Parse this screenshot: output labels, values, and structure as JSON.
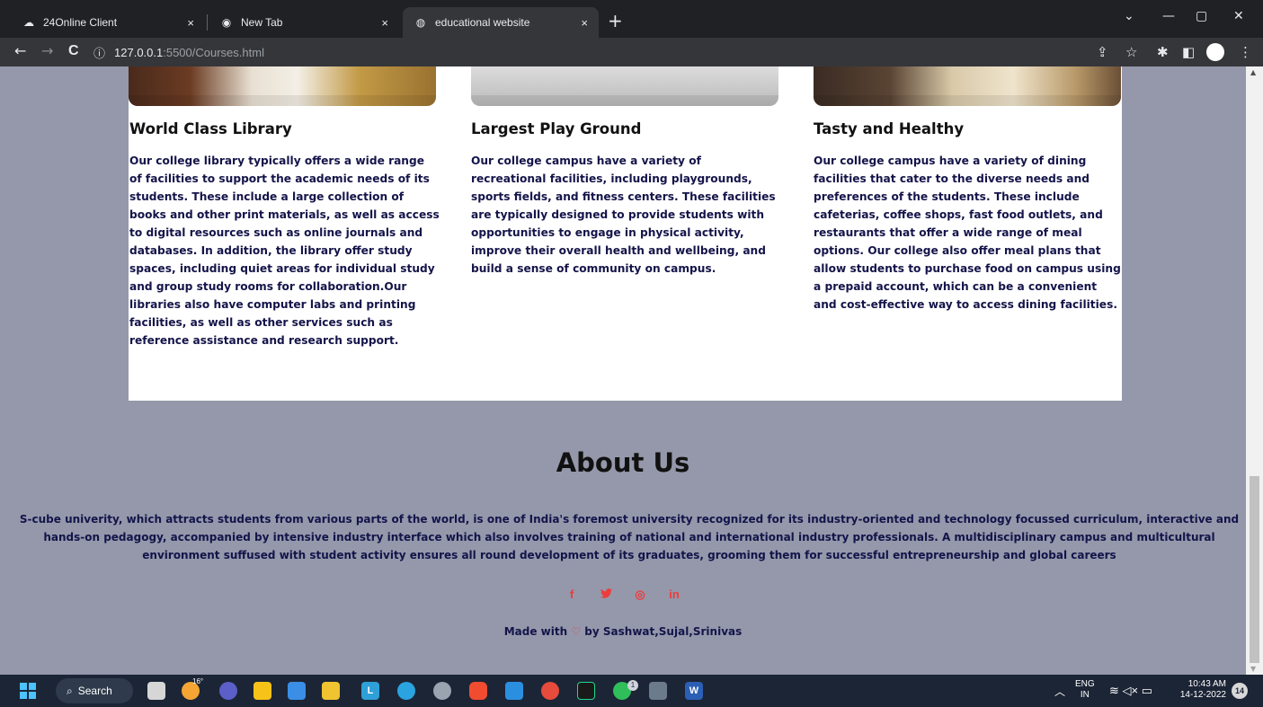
{
  "browser": {
    "tabs": [
      {
        "title": "24Online Client",
        "icon": "cloud-icon",
        "close": "×"
      },
      {
        "title": "New Tab",
        "icon": "chrome-icon",
        "close": "×"
      },
      {
        "title": "educational website",
        "icon": "globe-icon",
        "close": "×"
      }
    ],
    "new_tab": "+",
    "address": {
      "host": "127.0.0.1",
      "path": ":5500/Courses.html"
    },
    "controls": {
      "back": "←",
      "forward": "→",
      "reload": "C",
      "info": "ⓘ",
      "minimize": "—",
      "restore": "▢",
      "close": "✕",
      "tablist": "⌄"
    },
    "toolbar_icons": {
      "share": "⇪",
      "star": "☆",
      "extensions": "✱",
      "sidepanel": "◧",
      "menu": "⋮"
    }
  },
  "facilities": [
    {
      "title": "World Class Library",
      "text": "Our college library typically offers a wide range of facilities to support the academic needs of its students. These include a large collection of books and other print materials, as well as access to digital resources such as online journals and databases. In addition, the library offer study spaces, including quiet areas for individual study and group study rooms for collaboration.Our libraries also have computer labs and printing facilities, as well as other services such as reference assistance and research support."
    },
    {
      "title": "Largest Play Ground",
      "text": "Our college campus have a variety of recreational facilities, including playgrounds, sports fields, and fitness centers. These facilities are typically designed to provide students with opportunities to engage in physical activity, improve their overall health and wellbeing, and build a sense of community on campus."
    },
    {
      "title": "Tasty and Healthy",
      "text": "Our college campus have a variety of dining facilities that cater to the diverse needs and preferences of the students. These include cafeterias, coffee shops, fast food outlets, and restaurants that offer a wide range of meal options. Our college also offer meal plans that allow students to purchase food on campus using a prepaid account, which can be a convenient and cost-effective way to access dining facilities."
    }
  ],
  "about": {
    "title": "About Us",
    "text": "S-cube univerity, which attracts students from various parts of the world, is one of India's foremost university recognized for its industry-oriented and technology focussed curriculum, interactive and hands-on pedagogy, accompanied by intensive industry interface which also involves training of national and international industry professionals. A multidisciplinary campus and multicultural environment suffused with student activity ensures all round development of its graduates, grooming them for successful entrepreneurship and global careers"
  },
  "footer": {
    "socials": [
      {
        "icon": "facebook-icon",
        "glyph": "f"
      },
      {
        "icon": "twitter-icon",
        "glyph": "🐦"
      },
      {
        "icon": "instagram-icon",
        "glyph": "◎"
      },
      {
        "icon": "linkedin-icon",
        "glyph": "in"
      }
    ],
    "made_prefix": "Made with",
    "heart": "♡",
    "made_suffix": "by Sashwat,Sujal,Srinivas",
    "accent_color": "#ee3b3b"
  },
  "taskbar": {
    "search_label": "Search",
    "weather": "16°",
    "lang_top": "ENG",
    "lang_bottom": "IN",
    "time": "10:43 AM",
    "date": "14-12-2022",
    "notifications": "14",
    "telegram_badge": "1"
  },
  "colors": {
    "page_bg": "#9498aa",
    "text_dark_blue": "#14144a",
    "card_bg": "#ffffff"
  }
}
